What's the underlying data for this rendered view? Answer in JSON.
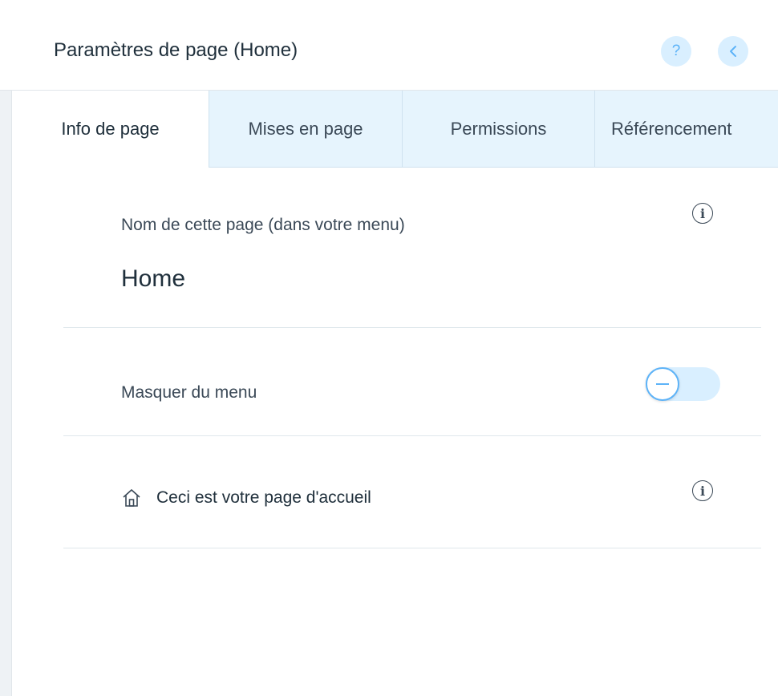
{
  "header": {
    "title": "Paramètres de page (Home)",
    "help_glyph": "?",
    "help_icon": "question-icon",
    "back_icon": "chevron-left-icon"
  },
  "tabs": [
    {
      "label": "Info de page",
      "active": true
    },
    {
      "label": "Mises en page",
      "active": false
    },
    {
      "label": "Permissions",
      "active": false
    },
    {
      "label": "Référencement",
      "active": false
    }
  ],
  "page_info": {
    "name_label": "Nom de cette page (dans votre menu)",
    "name_value": "Home",
    "hide_label": "Masquer du menu",
    "hide_toggle_on": false,
    "homepage_label": "Ceci est votre page d'accueil",
    "info_glyph": "i"
  },
  "colors": {
    "accent": "#5db3f8",
    "accent_light": "#d9efff",
    "tab_inactive_bg": "#e6f4fd",
    "text": "#20303c"
  }
}
